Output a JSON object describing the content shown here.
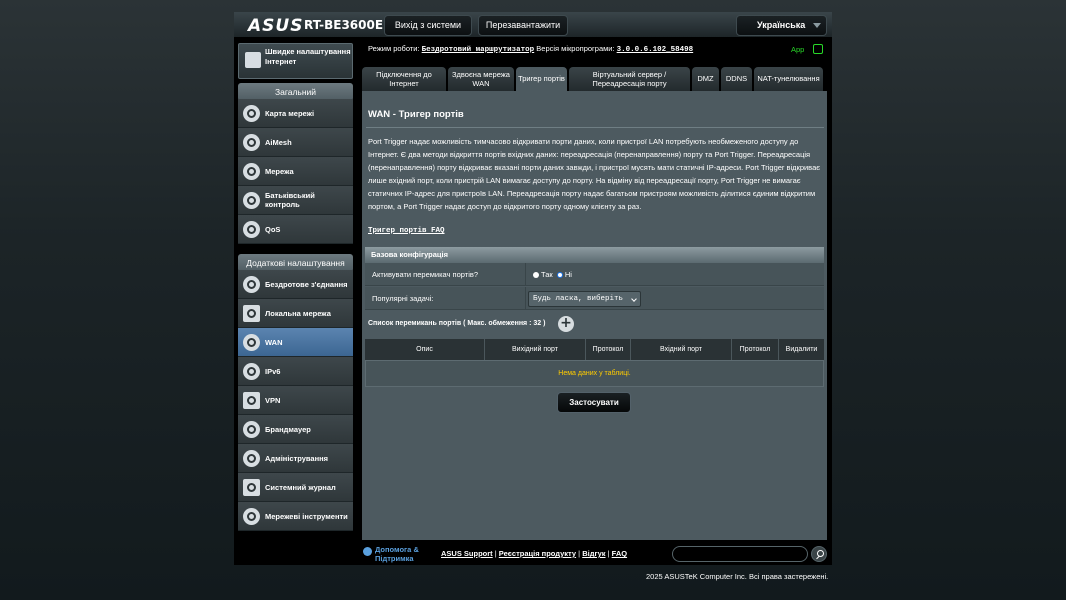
{
  "header": {
    "logo": "ASUS",
    "model": "RT-BE3600E",
    "logout_label": "Вихід з системи",
    "reboot_label": "Перезавантажити",
    "language": "Українська"
  },
  "status": {
    "mode_label": "Режим роботи:",
    "mode_value": "Бездротовий маршрутизатор",
    "fw_label": "Версія мікропрограми:",
    "fw_value": "3.0.0.6.102_58498",
    "app_label": "App"
  },
  "sidebar": {
    "qis_label": "Швидке налаштування Інтернет",
    "general_header": "Загальний",
    "general_items": [
      {
        "label": "Карта мережі",
        "icon": "network-map-icon"
      },
      {
        "label": "AiMesh",
        "icon": "aimesh-icon"
      },
      {
        "label": "Мережа",
        "icon": "network-icon"
      },
      {
        "label": "Батьківський контроль",
        "icon": "parental-control-icon"
      },
      {
        "label": "QoS",
        "icon": "qos-icon"
      }
    ],
    "advanced_header": "Додаткові налаштування",
    "advanced_items": [
      {
        "label": "Бездротове з'єднання",
        "icon": "wireless-icon"
      },
      {
        "label": "Локальна мережа",
        "icon": "lan-icon"
      },
      {
        "label": "WAN",
        "icon": "wan-icon"
      },
      {
        "label": "IPv6",
        "icon": "ipv6-icon"
      },
      {
        "label": "VPN",
        "icon": "vpn-icon"
      },
      {
        "label": "Брандмауер",
        "icon": "firewall-icon"
      },
      {
        "label": "Адміністрування",
        "icon": "administration-icon"
      },
      {
        "label": "Системний журнал",
        "icon": "system-log-icon"
      },
      {
        "label": "Мережеві інструменти",
        "icon": "network-tools-icon"
      }
    ]
  },
  "tabs": [
    {
      "label": "Підключення до Інтернет"
    },
    {
      "label": "Здвоєна мережа WAN"
    },
    {
      "label": "Тригер портів"
    },
    {
      "label": "Віртуальний сервер / Переадресація порту"
    },
    {
      "label": "DMZ"
    },
    {
      "label": "DDNS"
    },
    {
      "label": "NAT-тунелювання"
    }
  ],
  "page": {
    "title": "WAN - Тригер портів",
    "description": "Port Trigger надає можливість тимчасово відкривати порти даних, коли пристрої LAN потребують необмеженого доступу до Інтернет. Є два методи відкриття портів вхідних даних: переадресація (перенаправлення) порту та Port Trigger. Переадресація (перенаправлення) порту відкриває вказані порти даних завжди, і пристрої мусять мати статичні IP-адреси. Port Trigger відкриває лише вхідний порт, коли пристрій LAN вимагає доступу до порту. На відміну від переадресації порту, Port Trigger не вимагає статичних IP-адрес для пристроїв LAN. Переадресація порту надає багатьом пристроям можливість ділитися єдиним відкритим портом, а Port Trigger надає доступ до відкритого порту одному клієнту за раз.",
    "faq_link": "Тригер портів FAQ"
  },
  "basic_config": {
    "header": "Базова конфігурація",
    "enable_label": "Активувати перемикач портів?",
    "yes_label": "Так",
    "no_label": "Ні",
    "selected": "Ні",
    "popular_label": "Популярні задачі:",
    "popular_value": "Будь ласка, виберіть"
  },
  "trigger_list": {
    "title": "Список перемикань портів ( Макс. обмеження : 32 )",
    "columns": [
      "Опис",
      "Вихідний порт",
      "Протокол",
      "Вхідний порт",
      "Протокол",
      "Видалити"
    ],
    "empty_text": "Нема даних у таблиці."
  },
  "apply_label": "Застосувати",
  "footer": {
    "help_label": "Допомога & Підтримка",
    "support": "ASUS Support",
    "registration": "Реєстрація продукту",
    "feedback": "Відгук",
    "faq": "FAQ",
    "copyright": "2025 ASUSTeK Computer Inc. Всі права застережені."
  },
  "colors": {
    "accent": "#3c6692",
    "link": "#5aa0de",
    "empty_text": "#ffcc00",
    "app_green": "#28d828"
  }
}
